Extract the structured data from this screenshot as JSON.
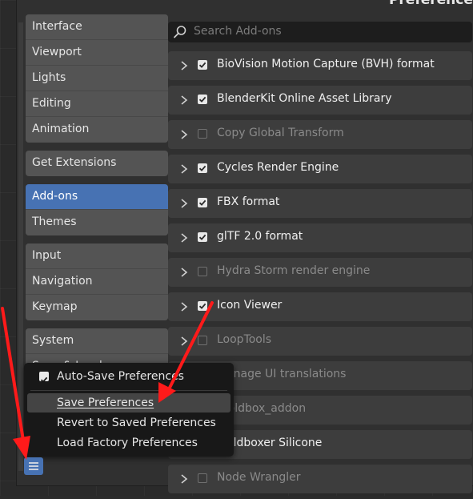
{
  "window": {
    "title_fragment": "Preferences"
  },
  "sidebar": {
    "groups": [
      {
        "items": [
          {
            "label": "Interface",
            "active": false
          },
          {
            "label": "Viewport",
            "active": false
          },
          {
            "label": "Lights",
            "active": false
          },
          {
            "label": "Editing",
            "active": false
          },
          {
            "label": "Animation",
            "active": false
          }
        ]
      },
      {
        "items": [
          {
            "label": "Get Extensions",
            "active": false
          }
        ]
      },
      {
        "items": [
          {
            "label": "Add-ons",
            "active": true
          },
          {
            "label": "Themes",
            "active": false
          }
        ]
      },
      {
        "items": [
          {
            "label": "Input",
            "active": false
          },
          {
            "label": "Navigation",
            "active": false
          },
          {
            "label": "Keymap",
            "active": false
          }
        ]
      },
      {
        "items": [
          {
            "label": "System",
            "active": false
          },
          {
            "label": "Save & Load",
            "active": false
          }
        ]
      }
    ]
  },
  "search": {
    "placeholder": "Search Add-ons"
  },
  "addons": [
    {
      "name": "BioVision Motion Capture (BVH) format",
      "enabled": true
    },
    {
      "name": "BlenderKit Online Asset Library",
      "enabled": true
    },
    {
      "name": "Copy Global Transform",
      "enabled": false
    },
    {
      "name": "Cycles Render Engine",
      "enabled": true
    },
    {
      "name": "FBX format",
      "enabled": true
    },
    {
      "name": "glTF 2.0 format",
      "enabled": true
    },
    {
      "name": "Hydra Storm render engine",
      "enabled": false
    },
    {
      "name": "Icon Viewer",
      "enabled": true
    },
    {
      "name": "LoopTools",
      "enabled": false
    },
    {
      "name": "Manage UI translations",
      "enabled": false
    },
    {
      "name": "moldbox_addon",
      "enabled": false
    },
    {
      "name": "Moldboxer Silicone",
      "enabled": true
    },
    {
      "name": "Node Wrangler",
      "enabled": false
    }
  ],
  "menu": {
    "auto_save": {
      "label": "Auto-Save Preferences",
      "checked": true
    },
    "save": "Save Preferences",
    "revert": "Revert to Saved Preferences",
    "load_factory": "Load Factory Preferences"
  },
  "colors": {
    "accent": "#4772b3",
    "annotation_arrow": "#ff1a1a"
  }
}
